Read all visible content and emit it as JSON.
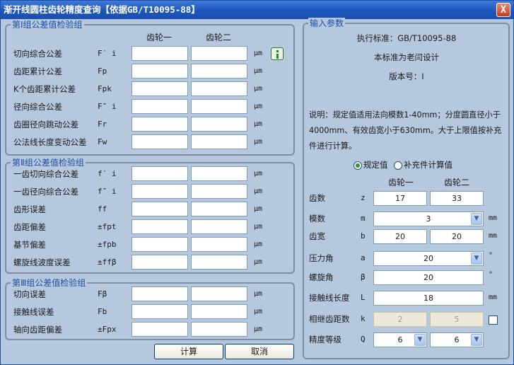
{
  "title": "渐开线圆柱齿轮精度查询【依据GB/T10095-88】",
  "close_glyph": "X",
  "col_headers": {
    "gear1": "齿轮一",
    "gear2": "齿轮二"
  },
  "groups": {
    "g1": {
      "title": "第Ⅰ组公差值检验组",
      "rows": [
        {
          "label": "切向综合公差",
          "symbol": "F′ i",
          "unit": "μm"
        },
        {
          "label": "齿距累计公差",
          "symbol": "Fp",
          "unit": "μm"
        },
        {
          "label": "K个齿距累计公差",
          "symbol": "Fpk",
          "unit": "μm"
        },
        {
          "label": "径向综合公差",
          "symbol": "F″ i",
          "unit": "μm"
        },
        {
          "label": "齿圈径向跳动公差",
          "symbol": "Fr",
          "unit": "μm"
        },
        {
          "label": "公法线长度变动公差",
          "symbol": "Fw",
          "unit": "μm"
        }
      ]
    },
    "g2": {
      "title": "第Ⅱ组公差值检验组",
      "rows": [
        {
          "label": "一齿切向综合公差",
          "symbol": "f′ i",
          "unit": "μm"
        },
        {
          "label": "一齿径向综合公差",
          "symbol": "f″ i",
          "unit": "μm"
        },
        {
          "label": "齿形误差",
          "symbol": "ff",
          "unit": "μm"
        },
        {
          "label": "齿距偏差",
          "symbol": "±fpt",
          "unit": "μm"
        },
        {
          "label": "基节偏差",
          "symbol": "±fpb",
          "unit": "μm"
        },
        {
          "label": "螺旋线波度误差",
          "symbol": "±ffβ",
          "unit": "μm"
        }
      ]
    },
    "g3": {
      "title": "第Ⅲ组公差值检验组",
      "rows": [
        {
          "label": "切向误差",
          "symbol": "Fβ",
          "unit": "μm"
        },
        {
          "label": "接触线误差",
          "symbol": "Fb",
          "unit": "μm"
        },
        {
          "label": "轴向齿距偏差",
          "symbol": "±Fpx",
          "unit": "μm"
        }
      ]
    }
  },
  "buttons": {
    "calc": "计算",
    "cancel": "取消"
  },
  "input": {
    "title": "输入参数",
    "standard": "执行标准：GB/T10095-88",
    "designer": "本标准为老闫设计",
    "version": "版本号：Ⅰ",
    "note": "说明：规定值适用法向模数1-40mm；分度圆直径小于4000mm、有效齿宽小于630mm。大于上限值按补充件进行计算。",
    "radio_spec": "规定值",
    "radio_supp": "补充件计算值",
    "params": {
      "teeth": {
        "label": "齿数",
        "sym": "z",
        "v1": "17",
        "v2": "33"
      },
      "module": {
        "label": "模数",
        "sym": "m",
        "value": "3",
        "unit": "mm"
      },
      "width": {
        "label": "齿宽",
        "sym": "b",
        "v1": "20",
        "v2": "20",
        "unit": "mm"
      },
      "pressure": {
        "label": "压力角",
        "sym": "a",
        "value": "20",
        "unit": "°"
      },
      "helix": {
        "label": "螺旋角",
        "sym": "β",
        "value": "20",
        "unit": "°"
      },
      "contact": {
        "label": "接触线长度",
        "sym": "L",
        "value": "18",
        "unit": "mm"
      },
      "span": {
        "label": "相继齿距数",
        "sym": "k",
        "v1": "2",
        "v2": "5"
      },
      "grade": {
        "label": "精度等级",
        "sym": "Q",
        "v1": "6",
        "v2": "6"
      }
    }
  }
}
